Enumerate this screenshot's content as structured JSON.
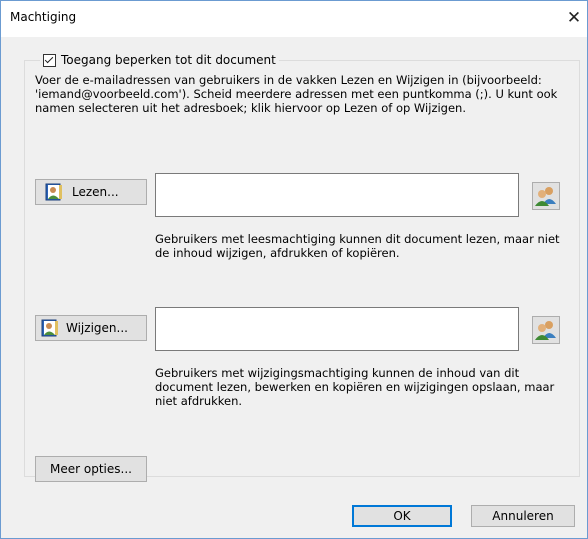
{
  "window": {
    "title": "Machtiging",
    "close_glyph": "✕"
  },
  "restrict": {
    "checkbox_label": "Toegang beperken tot dit document",
    "checked": true,
    "description": "Voer de e-mailadressen van gebruikers in de vakken Lezen en Wijzigen in (bijvoorbeeld: 'iemand@voorbeeld.com'). Scheid meerdere adressen met een puntkomma (;). U kunt ook namen selecteren uit het adresboek; klik hiervoor op Lezen of op Wijzigen."
  },
  "read": {
    "button_label": "Lezen...",
    "input_value": "",
    "help": "Gebruikers met leesmachtiging kunnen dit document lezen, maar niet de inhoud wijzigen, afdrukken of kopiëren."
  },
  "change": {
    "button_label": "Wijzigen...",
    "input_value": "",
    "help": "Gebruikers met wijzigingsmachtiging kunnen de inhoud van dit document lezen, bewerken en kopiëren en wijzigingen opslaan, maar niet afdrukken."
  },
  "more_options_label": "Meer opties...",
  "footer": {
    "ok_label": "OK",
    "cancel_label": "Annuleren"
  },
  "icons": {
    "address_book": "address-book-icon",
    "people": "people-icon"
  }
}
